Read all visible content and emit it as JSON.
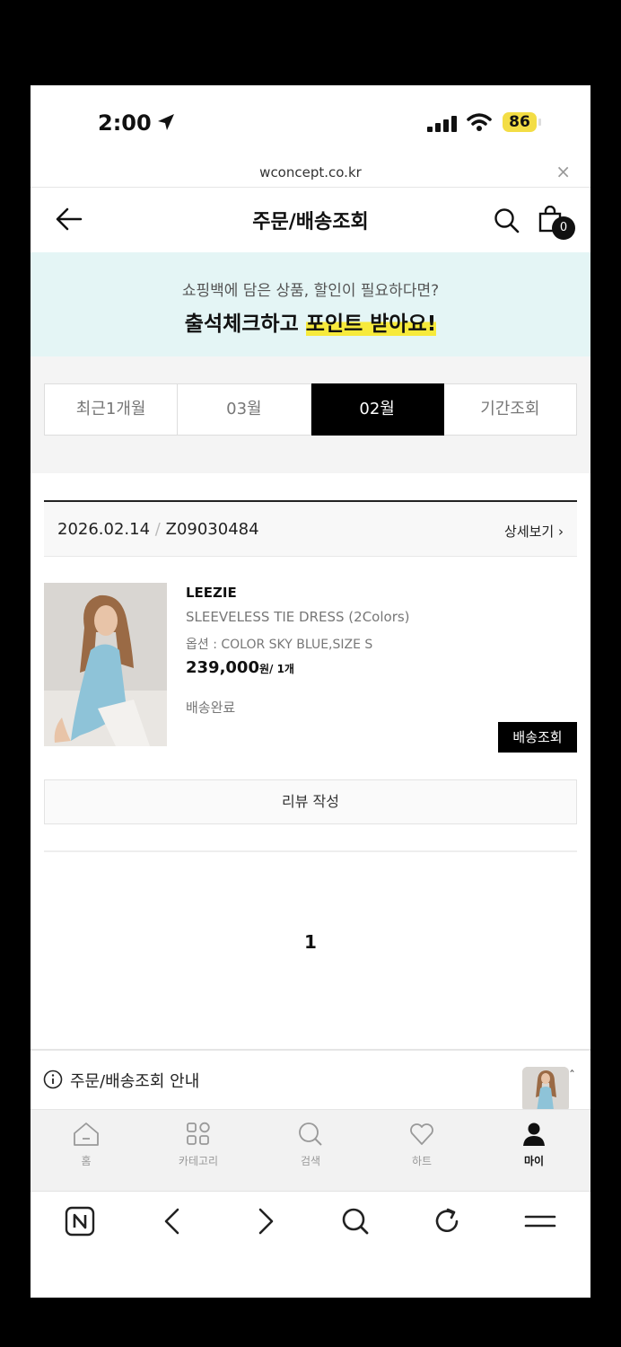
{
  "status_bar": {
    "time": "2:00",
    "battery": "86"
  },
  "browser": {
    "url": "wconcept.co.kr"
  },
  "header": {
    "title": "주문/배송조회",
    "cart_count": "0"
  },
  "banner": {
    "subtitle": "쇼핑백에 담은 상품, 할인이 필요하다면?",
    "title_prefix": "출석체크하고 ",
    "title_highlight": "포인트 받아요!"
  },
  "period_tabs": [
    {
      "label": "최근1개월",
      "active": false
    },
    {
      "label": "03월",
      "active": false
    },
    {
      "label": "02월",
      "active": true
    },
    {
      "label": "기간조회",
      "active": false
    }
  ],
  "order": {
    "date": "2026.02.14",
    "separator": "/",
    "number": "Z09030484",
    "detail_link": "상세보기",
    "product": {
      "brand": "LEEZIE",
      "name": "SLEEVELESS TIE DRESS (2Colors)",
      "option": "옵션 : COLOR SKY BLUE,SIZE S",
      "price": "239,000",
      "price_unit": "원/ 1개",
      "status": "배송완료"
    },
    "track_button": "배송조회",
    "review_button": "리뷰 작성"
  },
  "pagination": {
    "current": "1"
  },
  "guide": {
    "label": "주문/배송조회 안내"
  },
  "tab_bar": [
    {
      "label": "홈",
      "icon": "home-icon",
      "active": false
    },
    {
      "label": "카테고리",
      "icon": "category-icon",
      "active": false
    },
    {
      "label": "검색",
      "icon": "search-icon",
      "active": false
    },
    {
      "label": "하트",
      "icon": "heart-icon",
      "active": false
    },
    {
      "label": "마이",
      "icon": "person-icon",
      "active": true
    }
  ],
  "browser_toolbar": [
    "naver-icon",
    "back-icon",
    "forward-icon",
    "search-icon",
    "refresh-icon",
    "menu-icon"
  ]
}
